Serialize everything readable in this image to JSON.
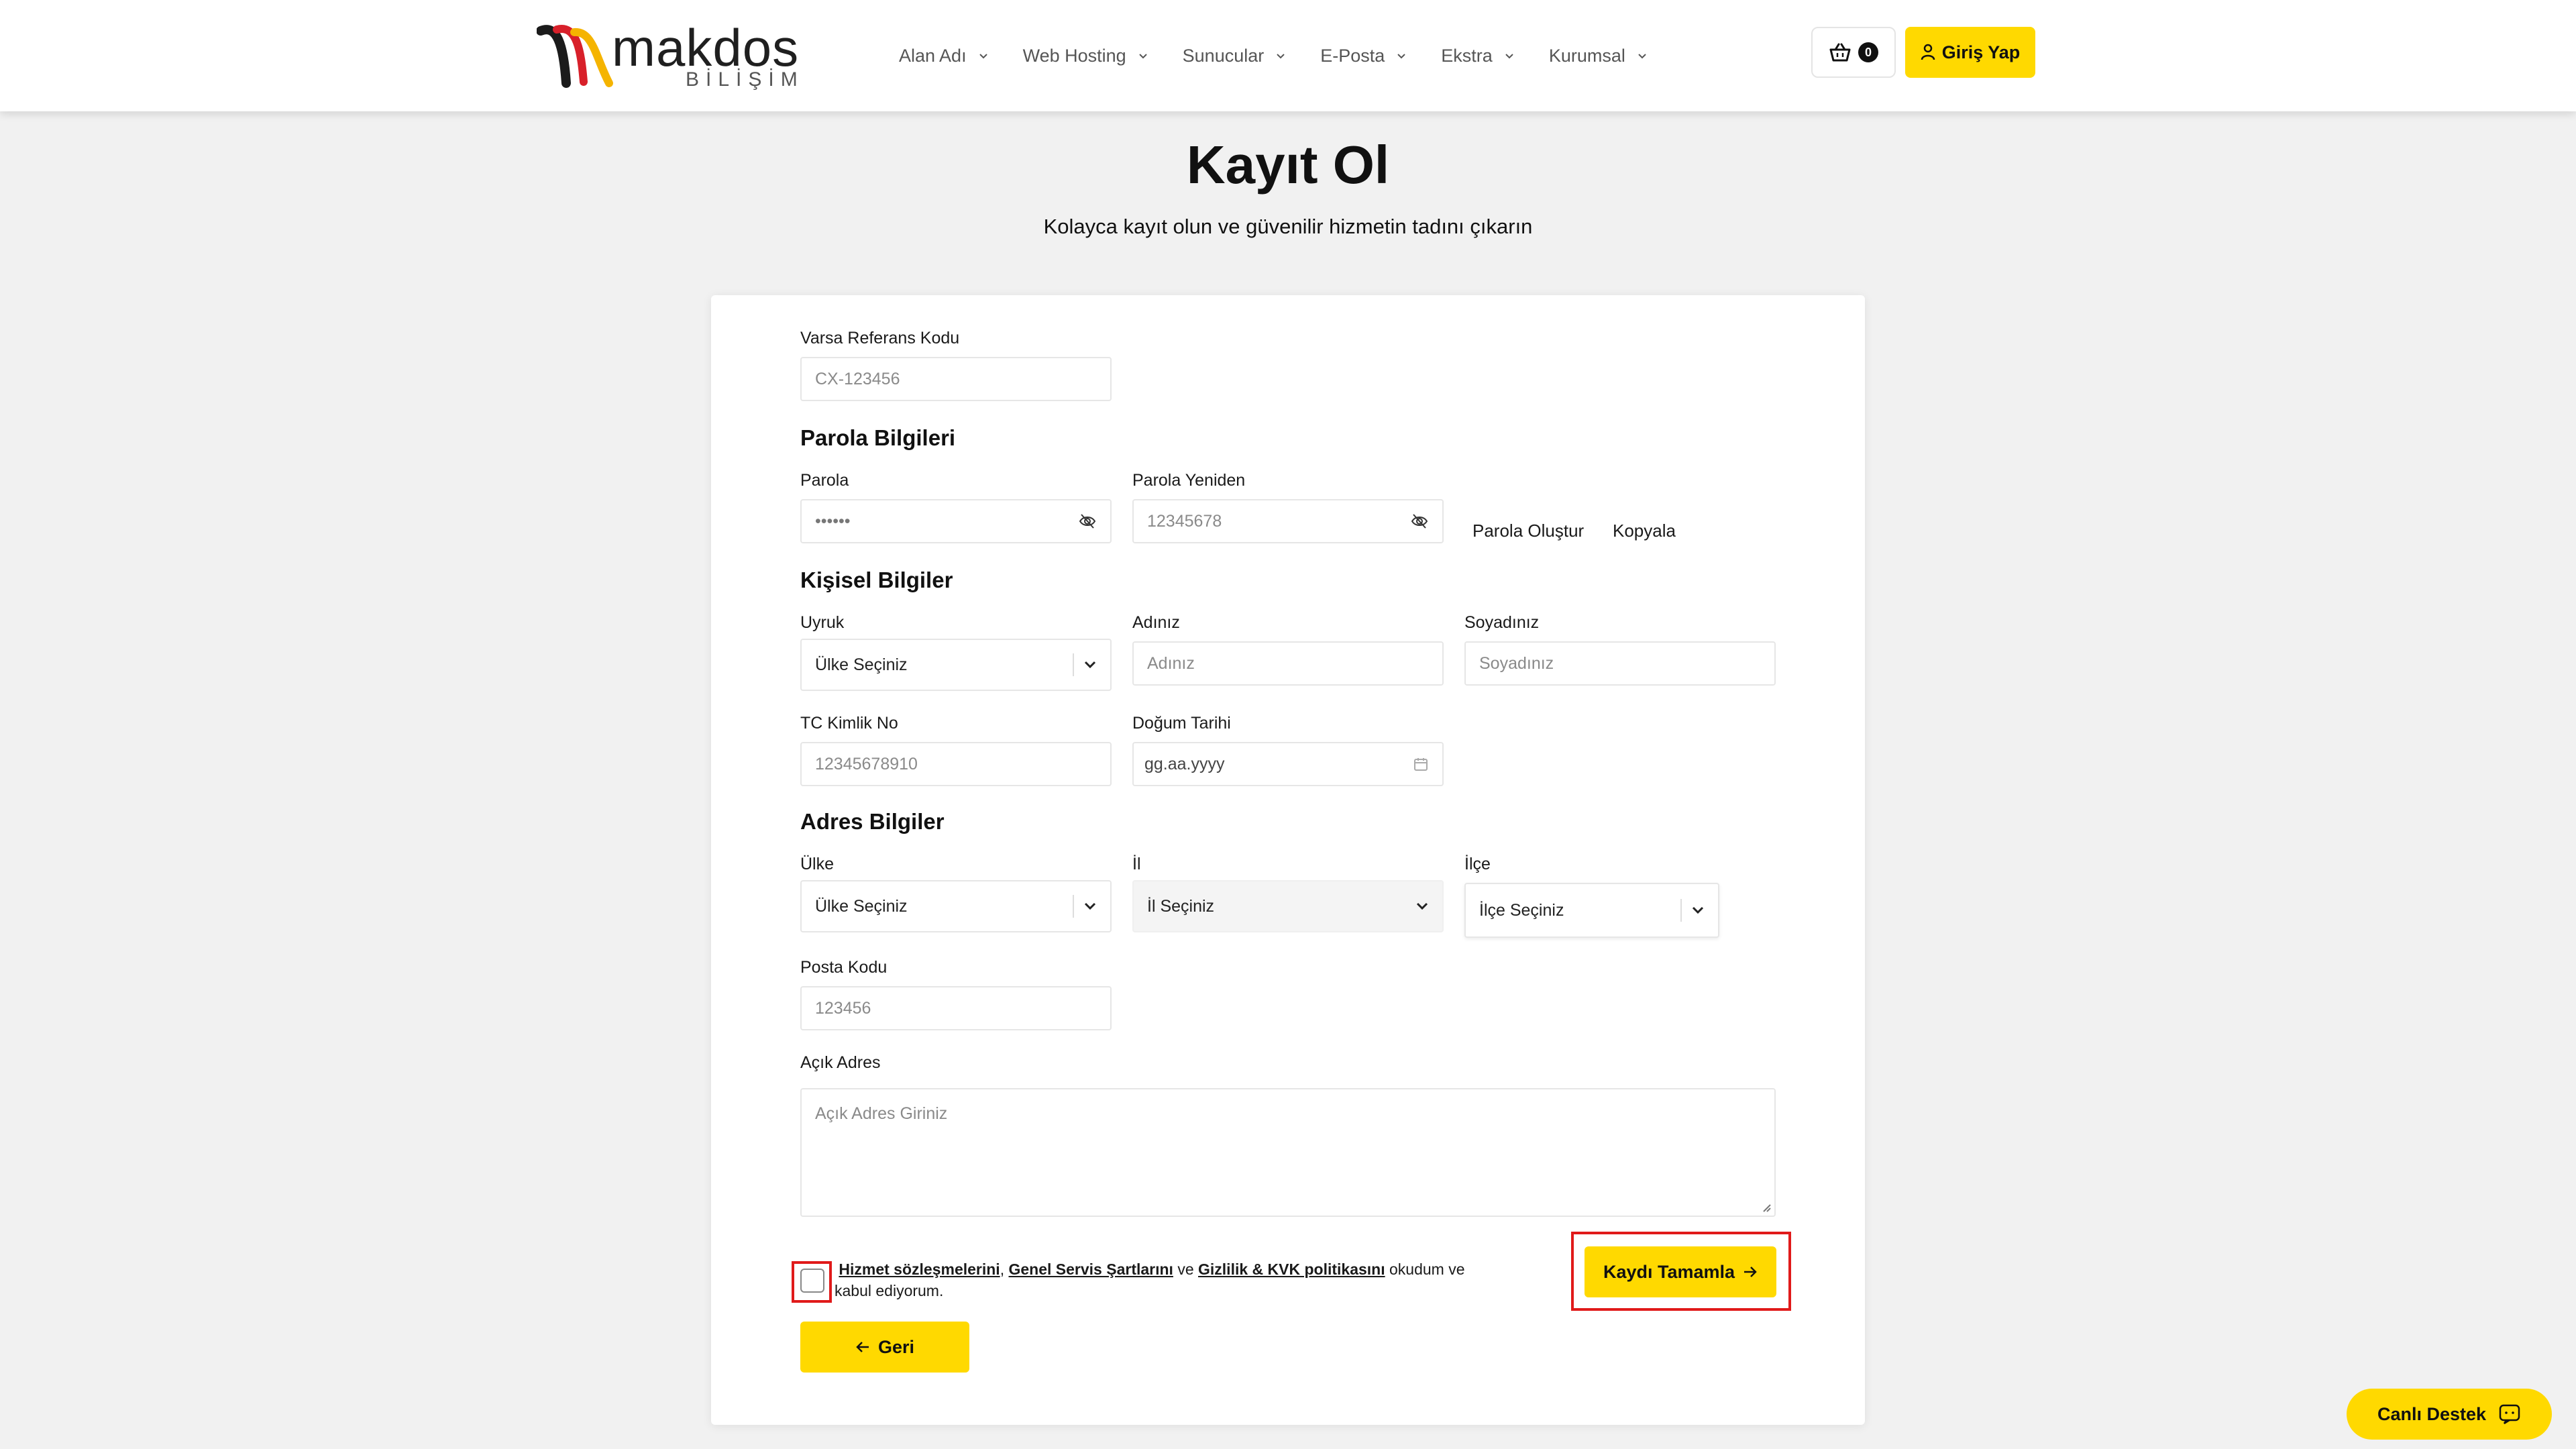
{
  "brand": {
    "name": "makdos",
    "sub": "BİLİŞİM"
  },
  "nav": [
    {
      "label": "Alan Adı"
    },
    {
      "label": "Web Hosting"
    },
    {
      "label": "Sunucular"
    },
    {
      "label": "E-Posta"
    },
    {
      "label": "Ekstra"
    },
    {
      "label": "Kurumsal"
    }
  ],
  "cart": {
    "count": "0"
  },
  "login_label": "Giriş Yap",
  "title": "Kayıt Ol",
  "subtitle": "Kolayca kayıt olun ve güvenilir hizmetin tadını çıkarın",
  "form": {
    "referral": {
      "label": "Varsa Referans Kodu",
      "placeholder": "CX-123456"
    },
    "password_section": "Parola Bilgileri",
    "password": {
      "label": "Parola",
      "value": "••••••"
    },
    "password_repeat": {
      "label": "Parola Yeniden",
      "placeholder": "12345678"
    },
    "generate_password": "Parola Oluştur",
    "copy": "Kopyala",
    "personal_section": "Kişisel Bilgiler",
    "nationality": {
      "label": "Uyruk",
      "value": "Ülke Seçiniz"
    },
    "first_name": {
      "label": "Adınız",
      "placeholder": "Adınız"
    },
    "last_name": {
      "label": "Soyadınız",
      "placeholder": "Soyadınız"
    },
    "tc_no": {
      "label": "TC Kimlik No",
      "placeholder": "12345678910"
    },
    "birth_date": {
      "label": "Doğum Tarihi",
      "placeholder": "gg.aa.yyyy"
    },
    "address_section": "Adres Bilgiler",
    "country": {
      "label": "Ülke",
      "value": "Ülke Seçiniz"
    },
    "city": {
      "label": "İl",
      "value": "İl Seçiniz"
    },
    "district": {
      "label": "İlçe",
      "value": "İlçe Seçiniz"
    },
    "postal_code": {
      "label": "Posta Kodu",
      "placeholder": "123456"
    },
    "address": {
      "label": "Açık Adres",
      "placeholder": "Açık Adres Giriniz"
    },
    "terms": {
      "link1": "Hizmet sözleşmelerini",
      "sep1": ", ",
      "link2": "Genel Servis Şartlarını",
      "sep2": " ve ",
      "link3": "Gizlilik & KVK politikasını",
      "tail": " okudum ve kabul ediyorum."
    },
    "submit_label": "Kaydı Tamamla",
    "back_label": "Geri"
  },
  "live_support_label": "Canlı Destek",
  "colors": {
    "accent": "#ffd900",
    "highlight": "#e01a1a"
  }
}
